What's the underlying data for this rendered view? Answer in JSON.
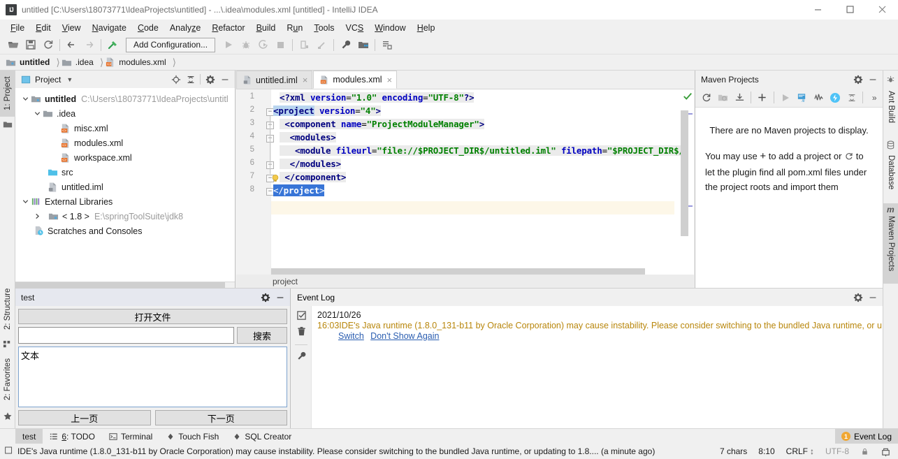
{
  "window": {
    "title": "untitled [C:\\Users\\18073771\\IdeaProjects\\untitled] - ...\\.idea\\modules.xml [untitled] - IntelliJ IDEA",
    "logo": "IJ",
    "minimize": "minimize-icon",
    "maximize": "maximize-icon",
    "close": "close-icon"
  },
  "menu": [
    {
      "label": "File"
    },
    {
      "label": "Edit"
    },
    {
      "label": "View"
    },
    {
      "label": "Navigate"
    },
    {
      "label": "Code"
    },
    {
      "label": "Analyze"
    },
    {
      "label": "Refactor"
    },
    {
      "label": "Build"
    },
    {
      "label": "Run"
    },
    {
      "label": "Tools"
    },
    {
      "label": "VCS"
    },
    {
      "label": "Window"
    },
    {
      "label": "Help"
    }
  ],
  "toolbar": {
    "run_config_label": "Add Configuration...",
    "icons": [
      "open-folder-icon",
      "save-all-icon",
      "sync-icon",
      "back-arrow-icon",
      "forward-arrow-icon",
      "build-hammer-icon",
      "run-icon",
      "debug-icon",
      "run-coverage-icon",
      "stop-icon",
      "profiler-icon",
      "attach-profiler-icon",
      "wrench-settings-icon",
      "project-structure-icon",
      "search-everywhere-icon"
    ]
  },
  "breadcrumb": [
    {
      "label": "untitled",
      "icon": "module-folder-icon"
    },
    {
      "label": ".idea",
      "icon": "folder-icon"
    },
    {
      "label": "modules.xml",
      "icon": "xml-file-icon"
    }
  ],
  "left_strip": [
    {
      "label": "1: Project",
      "selected": true
    },
    {
      "label": "2: Structure",
      "selected": false
    },
    {
      "label": "2: Favorites",
      "selected": false
    }
  ],
  "right_strip": [
    {
      "label": "Ant Build",
      "selected": false
    },
    {
      "label": "Database",
      "selected": false
    },
    {
      "label": "Maven Projects",
      "selected": true
    }
  ],
  "project_panel": {
    "title": "Project",
    "dropdown": "chevron-down-icon",
    "tree": [
      {
        "depth": 0,
        "chevron": "expanded",
        "icon": "module-folder-icon",
        "label": "untitled",
        "bold": true,
        "sub": "C:\\Users\\18073771\\IdeaProjects\\untitl"
      },
      {
        "depth": 1,
        "chevron": "expanded",
        "icon": "folder-icon",
        "label": ".idea",
        "bold": false,
        "sub": ""
      },
      {
        "depth": 2,
        "chevron": "none",
        "icon": "xml-file-icon",
        "label": "misc.xml",
        "bold": false,
        "sub": ""
      },
      {
        "depth": 2,
        "chevron": "none",
        "icon": "xml-file-icon",
        "label": "modules.xml",
        "bold": false,
        "sub": ""
      },
      {
        "depth": 2,
        "chevron": "none",
        "icon": "xml-file-icon",
        "label": "workspace.xml",
        "bold": false,
        "sub": ""
      },
      {
        "depth": 1,
        "chevron": "none",
        "icon": "source-folder-icon",
        "label": "src",
        "bold": false,
        "sub": ""
      },
      {
        "depth": 1,
        "chevron": "none",
        "icon": "iml-file-icon",
        "label": "untitled.iml",
        "bold": false,
        "sub": ""
      },
      {
        "depth": 0,
        "chevron": "expanded",
        "icon": "libraries-icon",
        "label": "External Libraries",
        "bold": false,
        "sub": ""
      },
      {
        "depth": 1,
        "chevron": "collapsed",
        "icon": "jdk-icon",
        "label": "< 1.8 >",
        "bold": false,
        "sub": "E:\\springToolSuite\\jdk8"
      },
      {
        "depth": 0,
        "chevron": "none",
        "icon": "scratches-icon",
        "label": "Scratches and Consoles",
        "bold": false,
        "sub": ""
      }
    ]
  },
  "editor": {
    "tabs": [
      {
        "label": "untitled.iml",
        "icon": "iml-file-icon",
        "active": false,
        "close": "close-icon"
      },
      {
        "label": "modules.xml",
        "icon": "xml-file-icon",
        "active": true,
        "close": "close-icon"
      }
    ],
    "lines": [
      {
        "n": "1",
        "fold": "",
        "text": "<?xml version=\"1.0\" encoding=\"UTF-8\"?>"
      },
      {
        "n": "2",
        "fold": "minus",
        "text": "<project version=\"4\">"
      },
      {
        "n": "3",
        "fold": "minus",
        "text": "  <component name=\"ProjectModuleManager\">"
      },
      {
        "n": "4",
        "fold": "minus",
        "text": "    <modules>"
      },
      {
        "n": "5",
        "fold": "",
        "text": "      <module fileurl=\"file://$PROJECT_DIR$/untitled.iml\" filepath=\"$PROJECT_DIR$/unti"
      },
      {
        "n": "6",
        "fold": "minus",
        "text": "    </modules>"
      },
      {
        "n": "7",
        "fold": "minus",
        "text": "  </component>"
      },
      {
        "n": "8",
        "fold": "minus",
        "text": "</project>"
      }
    ],
    "footer_breadcrumb": "project",
    "inspection_status": "ok-check-icon",
    "intention_bulb": "lightbulb-icon"
  },
  "maven_panel": {
    "title": "Maven Projects",
    "gear": "gear-icon",
    "hide": "hide-icon",
    "toolbar_icons": [
      "reload-icon",
      "generate-sources-icon",
      "download-sources-icon",
      "add-icon",
      "run-icon",
      "execute-goal-icon",
      "toggle-skip-tests-icon",
      "toggle-offline-icon",
      "collapse-all-icon",
      "more-icon"
    ],
    "empty_line1": "There are no Maven projects to display.",
    "empty_line2_a": "You may use",
    "empty_line2_plus": "+",
    "empty_line2_b": "to add a project or",
    "empty_line2_reload": "reload-icon",
    "empty_line2_c": "to",
    "empty_line3": "let the plugin find all pom.xml files under",
    "empty_line4": "the project roots and import them"
  },
  "test_panel": {
    "title": "test",
    "gear": "gear-icon",
    "hide": "hide-icon",
    "open_file_button": "打开文件",
    "search_input_value": "",
    "search_button": "搜索",
    "textarea_value": "文本",
    "prev_page_button": "上一页",
    "next_page_button": "下一页"
  },
  "event_log": {
    "title": "Event Log",
    "gear": "gear-icon",
    "hide": "hide-icon",
    "side_icons": [
      "mark-all-read-icon",
      "delete-icon",
      "settings-wrench-icon"
    ],
    "date": "2021/10/26",
    "time": "16:03",
    "message": "IDE's Java runtime (1.8.0_131-b11 by Oracle Corporation) may cause instability. Please consider switching to the bundled Java runtime, or u",
    "links": [
      {
        "label": "Switch"
      },
      {
        "label": "Don't Show Again"
      }
    ]
  },
  "bottom_tabs": [
    {
      "label": "test",
      "icon": "",
      "selected": true
    },
    {
      "label": "6: TODO",
      "icon": "todo-icon",
      "selected": false
    },
    {
      "label": "Terminal",
      "icon": "terminal-icon",
      "selected": false
    },
    {
      "label": "Touch Fish",
      "icon": "plugin-icon",
      "selected": false
    },
    {
      "label": "SQL Creator",
      "icon": "plugin-icon",
      "selected": false
    }
  ],
  "bottom_right_tab": {
    "badge": "1",
    "label": "Event Log"
  },
  "status_bar": {
    "icon": "info-icon",
    "message": "IDE's Java runtime (1.8.0_131-b11 by Oracle Corporation) may cause instability. Please consider switching to the bundled Java runtime, or updating to 1.8.... (a minute ago)",
    "chars": "7 chars",
    "caret": "8:10",
    "line_sep": "CRLF",
    "line_sep_arrow": "⇕",
    "encoding": "UTF-8",
    "lock": "lock-icon",
    "inspector": "inspector-icon"
  },
  "colors": {
    "accent_blue": "#3875d7",
    "link_blue": "#2a5db0",
    "warn_amber": "#b8860b",
    "badge_orange": "#f0a732",
    "tag_navy": "#000080",
    "attr_blue": "#0000c0",
    "value_green": "#008000",
    "panel_head": "#e6e8ef",
    "chrome_gray": "#f0f0f0"
  }
}
